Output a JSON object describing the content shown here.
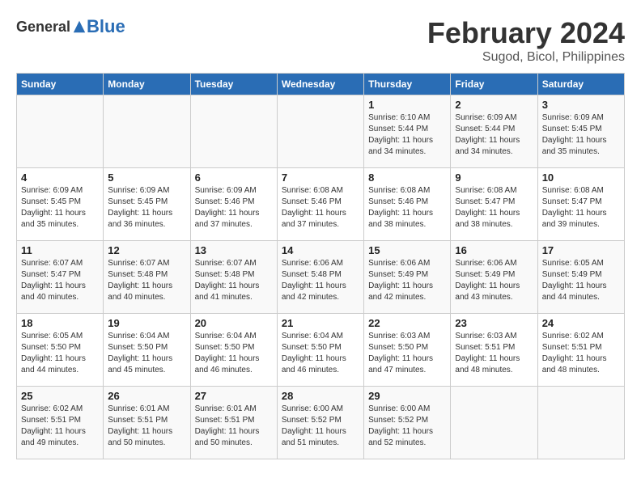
{
  "header": {
    "logo_general": "General",
    "logo_blue": "Blue",
    "month_year": "February 2024",
    "location": "Sugod, Bicol, Philippines"
  },
  "weekdays": [
    "Sunday",
    "Monday",
    "Tuesday",
    "Wednesday",
    "Thursday",
    "Friday",
    "Saturday"
  ],
  "weeks": [
    [
      {
        "day": "",
        "info": ""
      },
      {
        "day": "",
        "info": ""
      },
      {
        "day": "",
        "info": ""
      },
      {
        "day": "",
        "info": ""
      },
      {
        "day": "1",
        "info": "Sunrise: 6:10 AM\nSunset: 5:44 PM\nDaylight: 11 hours\nand 34 minutes."
      },
      {
        "day": "2",
        "info": "Sunrise: 6:09 AM\nSunset: 5:44 PM\nDaylight: 11 hours\nand 34 minutes."
      },
      {
        "day": "3",
        "info": "Sunrise: 6:09 AM\nSunset: 5:45 PM\nDaylight: 11 hours\nand 35 minutes."
      }
    ],
    [
      {
        "day": "4",
        "info": "Sunrise: 6:09 AM\nSunset: 5:45 PM\nDaylight: 11 hours\nand 35 minutes."
      },
      {
        "day": "5",
        "info": "Sunrise: 6:09 AM\nSunset: 5:45 PM\nDaylight: 11 hours\nand 36 minutes."
      },
      {
        "day": "6",
        "info": "Sunrise: 6:09 AM\nSunset: 5:46 PM\nDaylight: 11 hours\nand 37 minutes."
      },
      {
        "day": "7",
        "info": "Sunrise: 6:08 AM\nSunset: 5:46 PM\nDaylight: 11 hours\nand 37 minutes."
      },
      {
        "day": "8",
        "info": "Sunrise: 6:08 AM\nSunset: 5:46 PM\nDaylight: 11 hours\nand 38 minutes."
      },
      {
        "day": "9",
        "info": "Sunrise: 6:08 AM\nSunset: 5:47 PM\nDaylight: 11 hours\nand 38 minutes."
      },
      {
        "day": "10",
        "info": "Sunrise: 6:08 AM\nSunset: 5:47 PM\nDaylight: 11 hours\nand 39 minutes."
      }
    ],
    [
      {
        "day": "11",
        "info": "Sunrise: 6:07 AM\nSunset: 5:47 PM\nDaylight: 11 hours\nand 40 minutes."
      },
      {
        "day": "12",
        "info": "Sunrise: 6:07 AM\nSunset: 5:48 PM\nDaylight: 11 hours\nand 40 minutes."
      },
      {
        "day": "13",
        "info": "Sunrise: 6:07 AM\nSunset: 5:48 PM\nDaylight: 11 hours\nand 41 minutes."
      },
      {
        "day": "14",
        "info": "Sunrise: 6:06 AM\nSunset: 5:48 PM\nDaylight: 11 hours\nand 42 minutes."
      },
      {
        "day": "15",
        "info": "Sunrise: 6:06 AM\nSunset: 5:49 PM\nDaylight: 11 hours\nand 42 minutes."
      },
      {
        "day": "16",
        "info": "Sunrise: 6:06 AM\nSunset: 5:49 PM\nDaylight: 11 hours\nand 43 minutes."
      },
      {
        "day": "17",
        "info": "Sunrise: 6:05 AM\nSunset: 5:49 PM\nDaylight: 11 hours\nand 44 minutes."
      }
    ],
    [
      {
        "day": "18",
        "info": "Sunrise: 6:05 AM\nSunset: 5:50 PM\nDaylight: 11 hours\nand 44 minutes."
      },
      {
        "day": "19",
        "info": "Sunrise: 6:04 AM\nSunset: 5:50 PM\nDaylight: 11 hours\nand 45 minutes."
      },
      {
        "day": "20",
        "info": "Sunrise: 6:04 AM\nSunset: 5:50 PM\nDaylight: 11 hours\nand 46 minutes."
      },
      {
        "day": "21",
        "info": "Sunrise: 6:04 AM\nSunset: 5:50 PM\nDaylight: 11 hours\nand 46 minutes."
      },
      {
        "day": "22",
        "info": "Sunrise: 6:03 AM\nSunset: 5:50 PM\nDaylight: 11 hours\nand 47 minutes."
      },
      {
        "day": "23",
        "info": "Sunrise: 6:03 AM\nSunset: 5:51 PM\nDaylight: 11 hours\nand 48 minutes."
      },
      {
        "day": "24",
        "info": "Sunrise: 6:02 AM\nSunset: 5:51 PM\nDaylight: 11 hours\nand 48 minutes."
      }
    ],
    [
      {
        "day": "25",
        "info": "Sunrise: 6:02 AM\nSunset: 5:51 PM\nDaylight: 11 hours\nand 49 minutes."
      },
      {
        "day": "26",
        "info": "Sunrise: 6:01 AM\nSunset: 5:51 PM\nDaylight: 11 hours\nand 50 minutes."
      },
      {
        "day": "27",
        "info": "Sunrise: 6:01 AM\nSunset: 5:51 PM\nDaylight: 11 hours\nand 50 minutes."
      },
      {
        "day": "28",
        "info": "Sunrise: 6:00 AM\nSunset: 5:52 PM\nDaylight: 11 hours\nand 51 minutes."
      },
      {
        "day": "29",
        "info": "Sunrise: 6:00 AM\nSunset: 5:52 PM\nDaylight: 11 hours\nand 52 minutes."
      },
      {
        "day": "",
        "info": ""
      },
      {
        "day": "",
        "info": ""
      }
    ]
  ]
}
